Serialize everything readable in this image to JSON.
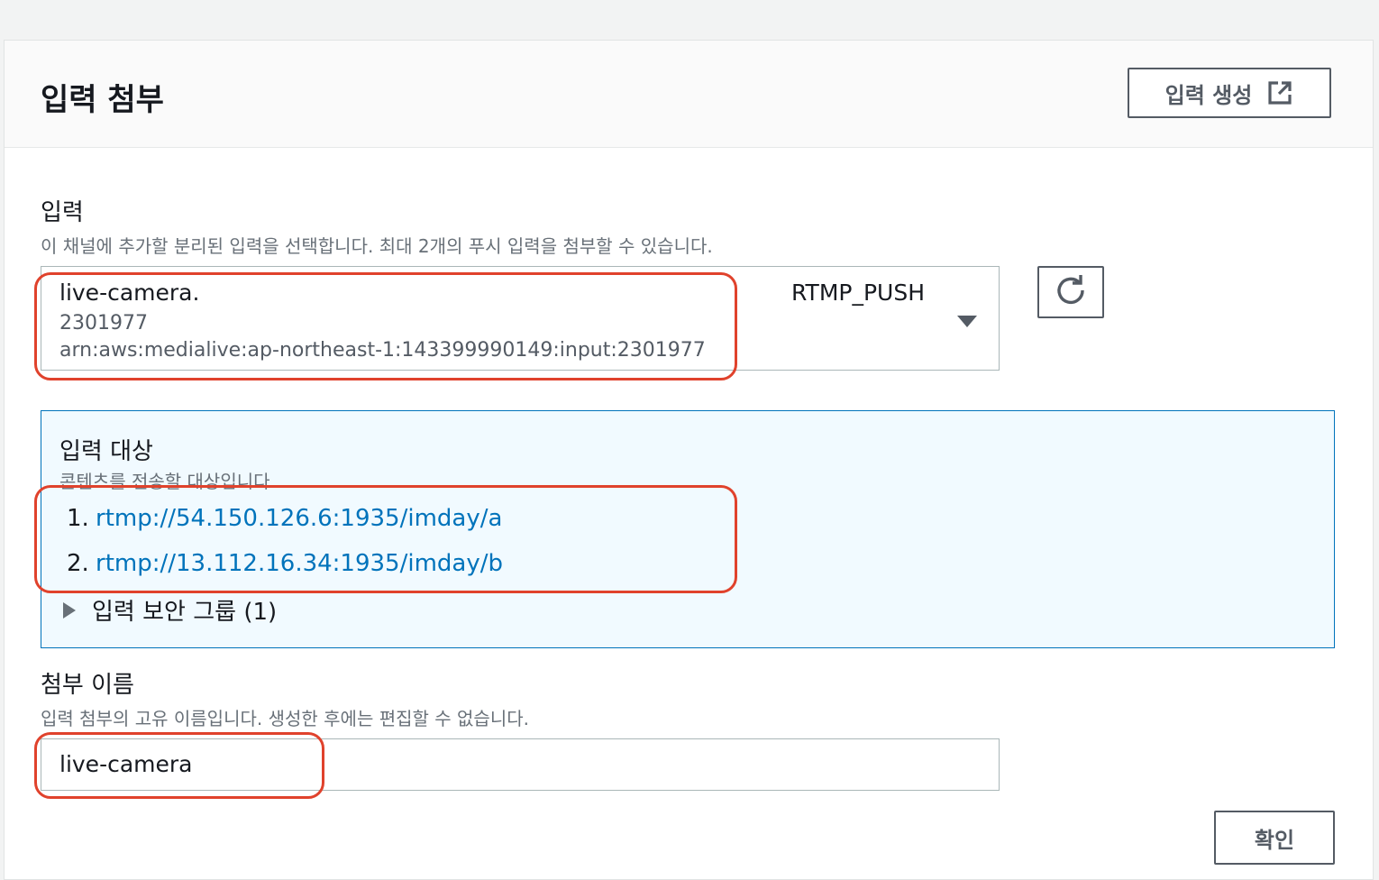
{
  "header": {
    "title": "입력 첨부",
    "create_button_label": "입력 생성"
  },
  "input_field": {
    "label": "입력",
    "description": "이 채널에 추가할 분리된 입력을 선택합니다. 최대 2개의 푸시 입력을 첨부할 수 있습니다.",
    "selected": {
      "name": "live-camera.",
      "id": "2301977",
      "arn": "arn:aws:medialive:ap-northeast-1:143399990149:input:2301977",
      "type": "RTMP_PUSH"
    }
  },
  "destinations": {
    "title": "입력 대상",
    "description": "콘텐츠를 전송할 대상입니다",
    "items": [
      {
        "num": "1.",
        "url": "rtmp://54.150.126.6:1935/imday/a"
      },
      {
        "num": "2.",
        "url": "rtmp://13.112.16.34:1935/imday/b"
      }
    ],
    "security_group_label": "입력 보안 그룹 (1)"
  },
  "attachment_name": {
    "label": "첨부 이름",
    "description": "입력 첨부의 고유 이름입니다. 생성한 후에는 편집할 수 없습니다.",
    "value": "live-camera"
  },
  "confirm_button_label": "확인",
  "colors": {
    "highlight": "#e0422c",
    "link": "#0073bb",
    "info_bg": "#f1faff"
  }
}
